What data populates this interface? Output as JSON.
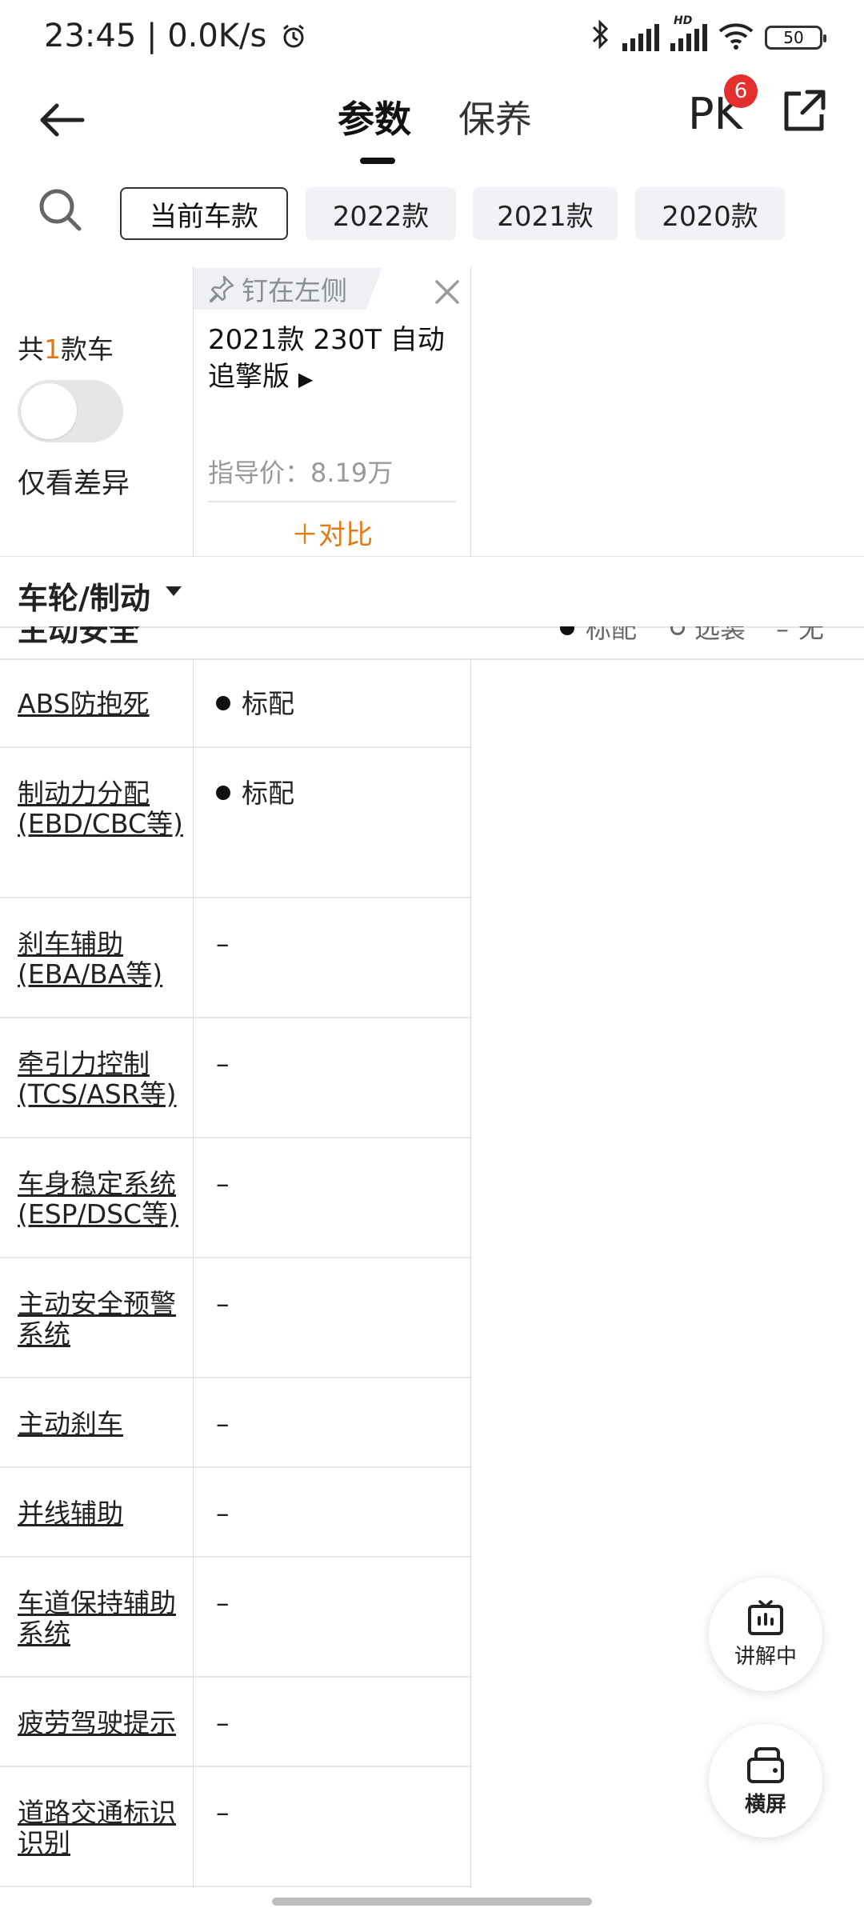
{
  "status_bar": {
    "time": "23:45",
    "speed": "0.0K/s",
    "battery": "50",
    "network_label": "HD"
  },
  "header": {
    "tabs": [
      {
        "label": "参数"
      },
      {
        "label": "保养"
      }
    ],
    "pk_label": "PK",
    "pk_badge": "6"
  },
  "filters": {
    "chips": [
      "当前车款",
      "2022款",
      "2021款",
      "2020款"
    ]
  },
  "car_panel": {
    "count_prefix": "共",
    "count_num": "1",
    "count_suffix": "款车",
    "diff_label": "仅看差异",
    "pin_label": "钉在左侧",
    "car_name": "2021款 230T 自动追擎版",
    "car_arrow": "▶",
    "price": "指导价：8.19万",
    "compare": "＋对比"
  },
  "section": {
    "title": "车轮/制动",
    "peek_title": "主动安全",
    "legend": {
      "std": "标配",
      "opt": "选装",
      "none": "无"
    }
  },
  "rows": [
    {
      "label": "ABS防抱死",
      "value": "标配",
      "std": true
    },
    {
      "label": "制动力分配(EBD/CBC等)",
      "value": "标配",
      "std": true
    },
    {
      "label": "刹车辅助(EBA/BA等)",
      "value": "–",
      "std": false
    },
    {
      "label": "牵引力控制(TCS/ASR等)",
      "value": "–",
      "std": false
    },
    {
      "label": "车身稳定系统(ESP/DSC等)",
      "value": "–",
      "std": false
    },
    {
      "label": "主动安全预警系统",
      "value": "–",
      "std": false
    },
    {
      "label": "主动刹车",
      "value": "–",
      "std": false
    },
    {
      "label": "并线辅助",
      "value": "–",
      "std": false
    },
    {
      "label": "车道保持辅助系统",
      "value": "–",
      "std": false
    },
    {
      "label": "疲劳驾驶提示",
      "value": "–",
      "std": false
    },
    {
      "label": "道路交通标识识别",
      "value": "–",
      "std": false
    }
  ],
  "fabs": {
    "explain": "讲解中",
    "landscape": "横屏"
  },
  "colors": {
    "accent": "#e07b18",
    "badge": "#e52e2e"
  }
}
